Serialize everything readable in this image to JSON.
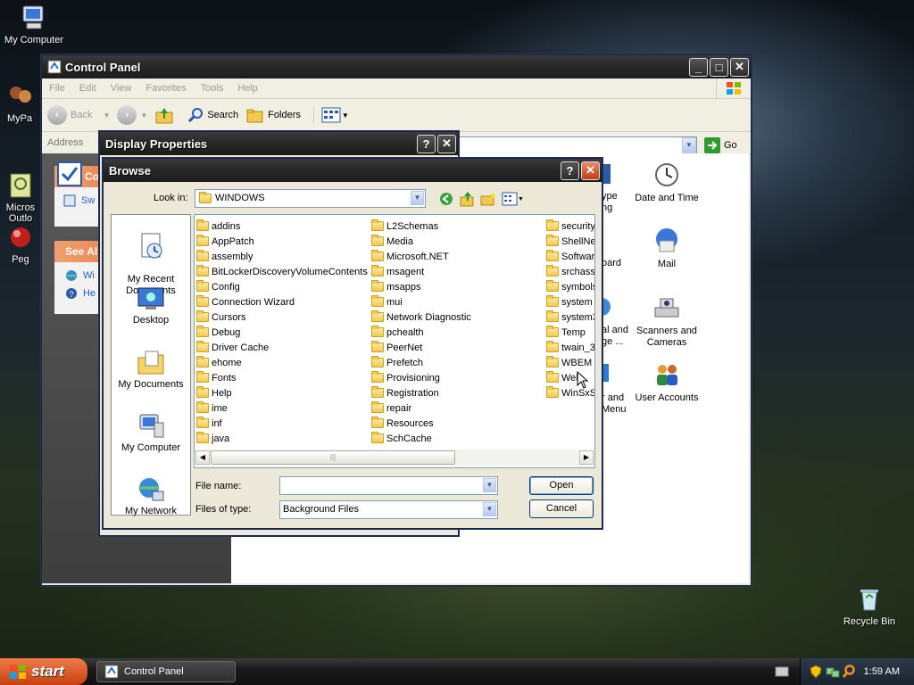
{
  "desktop": {
    "icons": [
      "My Computer",
      "MyPa",
      "Micros\nOutlo",
      "Peg",
      "Recycle Bin"
    ]
  },
  "control_panel": {
    "title": "Control Panel",
    "menu": [
      "File",
      "Edit",
      "View",
      "Favorites",
      "Tools",
      "Help"
    ],
    "toolbar": {
      "back": "Back",
      "search": "Search",
      "folders": "Folders"
    },
    "address_label": "Address",
    "go_label": "Go",
    "left_pane": {
      "box1_title": "Co",
      "box1_item": "Sw",
      "box2_title": "See Al",
      "box2_items": [
        "Wi",
        "He"
      ]
    },
    "items": [
      {
        "label": "ype\nng"
      },
      {
        "label": "Date and Time"
      },
      {
        "label": "oard"
      },
      {
        "label": "Mail"
      },
      {
        "label": "al and\nge ..."
      },
      {
        "label": "Scanners and\nCameras"
      },
      {
        "label": "r and\nMenu"
      },
      {
        "label": "User Accounts"
      }
    ]
  },
  "display_properties": {
    "title": "Display Properties"
  },
  "browse": {
    "title": "Browse",
    "look_in_label": "Look in:",
    "look_in_value": "WINDOWS",
    "places": [
      "My Recent\nDocuments",
      "Desktop",
      "My Documents",
      "My Computer",
      "My Network"
    ],
    "folders_col1": [
      "addins",
      "AppPatch",
      "assembly",
      "BitLockerDiscoveryVolumeContents",
      "Config",
      "Connection Wizard",
      "Cursors",
      "Debug",
      "Driver Cache",
      "ehome",
      "Fonts",
      "Help",
      "ime",
      "inf",
      "java"
    ],
    "folders_col2": [
      "L2Schemas",
      "Media",
      "Microsoft.NET",
      "msagent",
      "msapps",
      "mui",
      "Network Diagnostic",
      "pchealth",
      "PeerNet",
      "Prefetch",
      "Provisioning",
      "Registration",
      "repair",
      "Resources",
      "SchCache"
    ],
    "folders_col3": [
      "security",
      "ShellNe",
      "Softwar",
      "srchass",
      "symbols",
      "system",
      "system3",
      "Temp",
      "twain_3",
      "WBEM",
      "Web",
      "WinSxS"
    ],
    "file_name_label": "File name:",
    "file_name_value": "",
    "files_of_type_label": "Files of type:",
    "files_of_type_value": "Background Files",
    "open_label": "Open",
    "cancel_label": "Cancel"
  },
  "taskbar": {
    "start_label": "start",
    "task_label": "Control Panel",
    "clock": "1:59 AM"
  }
}
